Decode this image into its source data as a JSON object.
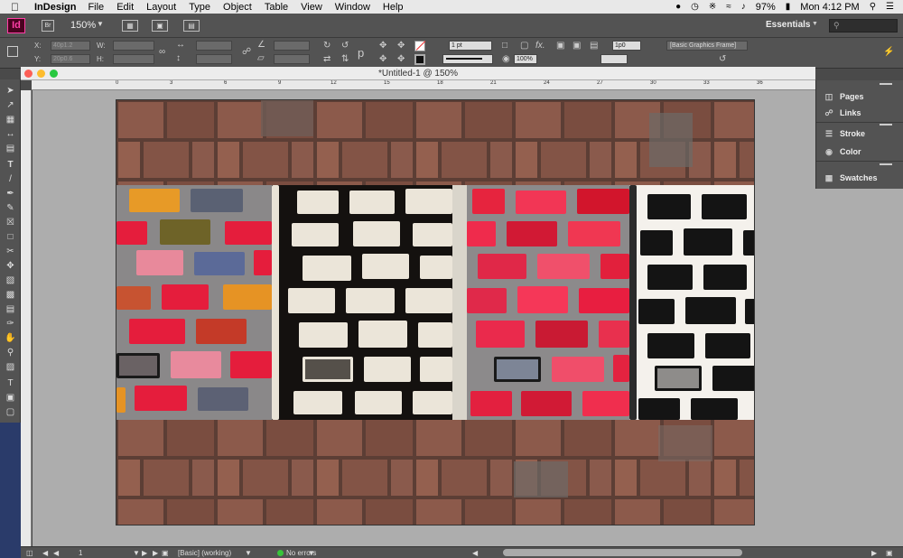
{
  "menubar": {
    "app_name": "InDesign",
    "items": [
      "File",
      "Edit",
      "Layout",
      "Type",
      "Object",
      "Table",
      "View",
      "Window",
      "Help"
    ],
    "battery": "97%",
    "clock": "Mon 4:12 PM"
  },
  "appbar": {
    "logo": "Id",
    "bridge": "Br",
    "zoom": "150%",
    "workspace": "Essentials"
  },
  "control": {
    "x_label": "X:",
    "y_label": "Y:",
    "w_label": "W:",
    "h_label": "H:",
    "x_value": "40p1.2",
    "y_value": "20p0.6",
    "stroke_weight": "1 pt",
    "opacity": "100%",
    "offset": "1p0",
    "object_style": "[Basic Graphics Frame]"
  },
  "document": {
    "title": "*Untitled-1 @ 150%",
    "ruler_numbers": [
      "0",
      "3",
      "6",
      "9",
      "12",
      "15",
      "18",
      "21",
      "24",
      "27",
      "30",
      "33",
      "36"
    ]
  },
  "panels": {
    "items": [
      {
        "label": "Pages",
        "icon": "pages-icon"
      },
      {
        "label": "Links",
        "icon": "links-icon"
      },
      {
        "label": "Stroke",
        "icon": "stroke-icon"
      },
      {
        "label": "Color",
        "icon": "color-icon"
      },
      {
        "label": "Swatches",
        "icon": "swatches-icon"
      }
    ]
  },
  "status": {
    "page_number": "1",
    "preflight_profile": "[Basic] (working)",
    "preflight_status": "No errors"
  },
  "colors": {
    "accent": "#ff3ea5",
    "ui_dark": "#535353",
    "pasteboard": "#adadad",
    "no_errors": "#38c43a"
  }
}
